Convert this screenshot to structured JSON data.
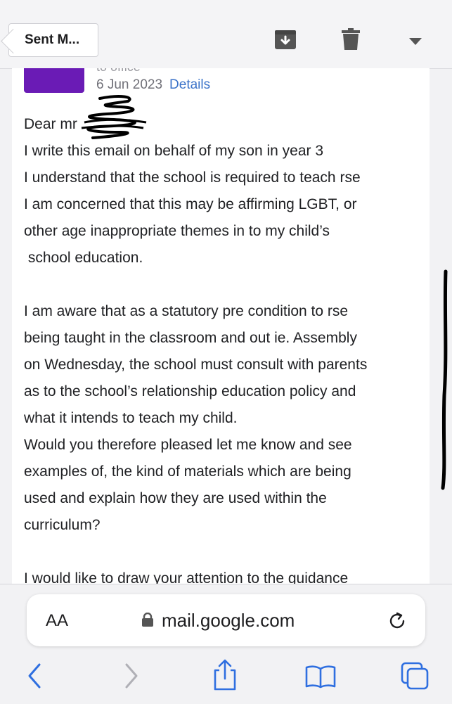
{
  "toolbar": {
    "back_label": "Sent M..."
  },
  "email": {
    "recipient_partial": "to office",
    "date": "6 Jun 2023",
    "details_label": "Details",
    "greeting": "Dear mr",
    "paragraphs": [
      [
        "I write this email on behalf of my son in year 3",
        "I understand that the school is required to teach rse",
        "I am concerned that this may be affirming LGBT, or",
        "other age inappropriate themes in to my child’s",
        " school education."
      ],
      [
        "I am aware that as a statutory pre condition to rse",
        "being taught in the classroom and out ie. Assembly",
        "on Wednesday, the school must consult with parents",
        "as to the school’s relationship education policy and",
        "what it intends to teach my child.",
        "Would you therefore pleased let me know and see",
        "examples of, the kind of materials which are being",
        "used and explain how they are used within the",
        "curriculum?"
      ],
      [
        "I would like to draw your attention to the guidance"
      ]
    ]
  },
  "browser": {
    "text_size_label": "AA",
    "url": "mail.google.com"
  },
  "icons": {
    "archive": "archive-icon",
    "trash": "trash-icon",
    "more": "chevron-down-icon",
    "lock": "lock-icon",
    "reload": "reload-icon",
    "back": "back-arrow-icon",
    "forward": "forward-arrow-icon",
    "share": "share-icon",
    "bookmarks": "bookmarks-icon",
    "tabs": "tabs-icon"
  },
  "colors": {
    "accent": "#3b73c9",
    "avatar": "#6a1bb5",
    "nav_active": "#2f6fe0",
    "nav_disabled": "#b0b0b6"
  }
}
